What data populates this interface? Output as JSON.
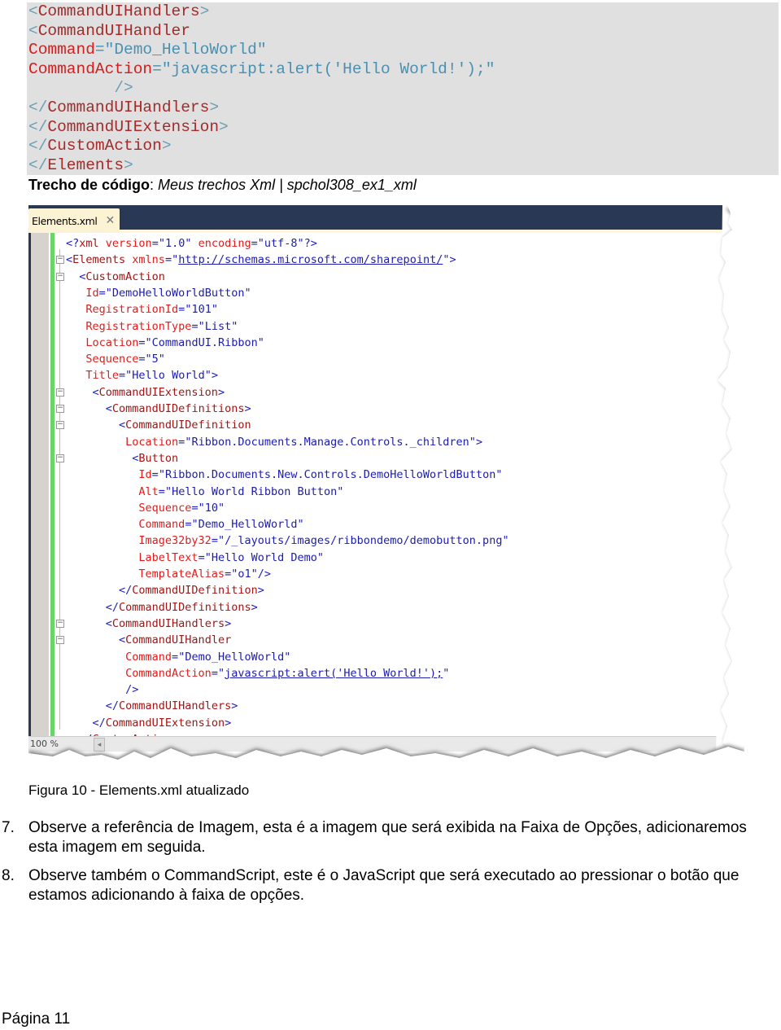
{
  "snippet": {
    "lines": [
      [
        {
          "t": "<",
          "c": "br"
        },
        {
          "t": "CommandUIHandlers",
          "c": "el"
        },
        {
          "t": ">",
          "c": "br"
        }
      ],
      [
        {
          "t": "<",
          "c": "br"
        },
        {
          "t": "CommandUIHandler",
          "c": "el"
        }
      ],
      [
        {
          "t": "Command",
          "c": "at"
        },
        {
          "t": "=\"Demo_HelloWorld\"",
          "c": "va"
        }
      ],
      [
        {
          "t": "CommandAction",
          "c": "at"
        },
        {
          "t": "=\"javascript:alert('Hello World!');\"",
          "c": "va"
        }
      ],
      [
        {
          "t": "         />",
          "c": "br"
        }
      ],
      [
        {
          "t": "</",
          "c": "br"
        },
        {
          "t": "CommandUIHandlers",
          "c": "el"
        },
        {
          "t": ">",
          "c": "br"
        }
      ],
      [
        {
          "t": "</",
          "c": "br"
        },
        {
          "t": "CommandUIExtension",
          "c": "el"
        },
        {
          "t": ">",
          "c": "br"
        }
      ],
      [
        {
          "t": "</",
          "c": "br"
        },
        {
          "t": "CustomAction",
          "c": "el"
        },
        {
          "t": ">",
          "c": "br"
        }
      ],
      [
        {
          "t": "</",
          "c": "br"
        },
        {
          "t": "Elements",
          "c": "el"
        },
        {
          "t": ">",
          "c": "br"
        }
      ]
    ],
    "caption_bold": "Trecho de código",
    "caption_sep": ": ",
    "caption_italic": "Meus trechos Xml | spchol308_ex1_xml"
  },
  "editor": {
    "tab_label": "Elements.xml",
    "tab_close_icon": "✕",
    "zoom_label": "100 %",
    "scroll_left_icon": "◂",
    "fold_icon": "−",
    "lines": [
      [
        {
          "t": "<?",
          "c": "pu"
        },
        {
          "t": "xml",
          "c": "el"
        },
        {
          "t": " version",
          "c": "at"
        },
        {
          "t": "=",
          "c": "pu"
        },
        {
          "t": "\"1.0\"",
          "c": "va"
        },
        {
          "t": " encoding",
          "c": "at"
        },
        {
          "t": "=",
          "c": "pu"
        },
        {
          "t": "\"utf-8\"",
          "c": "va"
        },
        {
          "t": "?>",
          "c": "pu"
        }
      ],
      [
        {
          "t": "<",
          "c": "pu"
        },
        {
          "t": "Elements",
          "c": "el"
        },
        {
          "t": " xmlns",
          "c": "at"
        },
        {
          "t": "=\"",
          "c": "pu"
        },
        {
          "t": "http://schemas.microsoft.com/sharepoint/",
          "c": "ln"
        },
        {
          "t": "\">",
          "c": "pu"
        }
      ],
      [
        {
          "t": "  <",
          "c": "pu"
        },
        {
          "t": "CustomAction",
          "c": "el"
        }
      ],
      [
        {
          "t": "   Id",
          "c": "at"
        },
        {
          "t": "=",
          "c": "pu"
        },
        {
          "t": "\"DemoHelloWorldButton\"",
          "c": "va"
        }
      ],
      [
        {
          "t": "   RegistrationId",
          "c": "at"
        },
        {
          "t": "=",
          "c": "pu"
        },
        {
          "t": "\"101\"",
          "c": "va"
        }
      ],
      [
        {
          "t": "   RegistrationType",
          "c": "at"
        },
        {
          "t": "=",
          "c": "pu"
        },
        {
          "t": "\"List\"",
          "c": "va"
        }
      ],
      [
        {
          "t": "   Location",
          "c": "at"
        },
        {
          "t": "=",
          "c": "pu"
        },
        {
          "t": "\"CommandUI.Ribbon\"",
          "c": "va"
        }
      ],
      [
        {
          "t": "   Sequence",
          "c": "at"
        },
        {
          "t": "=",
          "c": "pu"
        },
        {
          "t": "\"5\"",
          "c": "va"
        }
      ],
      [
        {
          "t": "   Title",
          "c": "at"
        },
        {
          "t": "=",
          "c": "pu"
        },
        {
          "t": "\"Hello World\"",
          "c": "va"
        },
        {
          "t": ">",
          "c": "pu"
        }
      ],
      [
        {
          "t": "    <",
          "c": "pu"
        },
        {
          "t": "CommandUIExtension",
          "c": "el"
        },
        {
          "t": ">",
          "c": "pu"
        }
      ],
      [
        {
          "t": "      <",
          "c": "pu"
        },
        {
          "t": "CommandUIDefinitions",
          "c": "el"
        },
        {
          "t": ">",
          "c": "pu"
        }
      ],
      [
        {
          "t": "        <",
          "c": "pu"
        },
        {
          "t": "CommandUIDefinition",
          "c": "el"
        }
      ],
      [
        {
          "t": "         Location",
          "c": "at"
        },
        {
          "t": "=",
          "c": "pu"
        },
        {
          "t": "\"Ribbon.Documents.Manage.Controls._children\"",
          "c": "va"
        },
        {
          "t": ">",
          "c": "pu"
        }
      ],
      [
        {
          "t": "          <",
          "c": "pu"
        },
        {
          "t": "Button",
          "c": "el"
        }
      ],
      [
        {
          "t": "           Id",
          "c": "at"
        },
        {
          "t": "=",
          "c": "pu"
        },
        {
          "t": "\"Ribbon.Documents.New.Controls.DemoHelloWorldButton\"",
          "c": "va"
        }
      ],
      [
        {
          "t": "           Alt",
          "c": "at"
        },
        {
          "t": "=",
          "c": "pu"
        },
        {
          "t": "\"Hello World Ribbon Button\"",
          "c": "va"
        }
      ],
      [
        {
          "t": "           Sequence",
          "c": "at"
        },
        {
          "t": "=",
          "c": "pu"
        },
        {
          "t": "\"10\"",
          "c": "va"
        }
      ],
      [
        {
          "t": "           Command",
          "c": "at"
        },
        {
          "t": "=",
          "c": "pu"
        },
        {
          "t": "\"Demo_HelloWorld\"",
          "c": "va"
        }
      ],
      [
        {
          "t": "           Image32by32",
          "c": "at"
        },
        {
          "t": "=",
          "c": "pu"
        },
        {
          "t": "\"/_layouts/images/ribbondemo/demobutton.png\"",
          "c": "va"
        }
      ],
      [
        {
          "t": "           LabelText",
          "c": "at"
        },
        {
          "t": "=",
          "c": "pu"
        },
        {
          "t": "\"Hello World Demo\"",
          "c": "va"
        }
      ],
      [
        {
          "t": "           TemplateAlias",
          "c": "at"
        },
        {
          "t": "=",
          "c": "pu"
        },
        {
          "t": "\"o1\"",
          "c": "va"
        },
        {
          "t": "/>",
          "c": "pu"
        }
      ],
      [
        {
          "t": "        </",
          "c": "pu"
        },
        {
          "t": "CommandUIDefinition",
          "c": "el"
        },
        {
          "t": ">",
          "c": "pu"
        }
      ],
      [
        {
          "t": "      </",
          "c": "pu"
        },
        {
          "t": "CommandUIDefinitions",
          "c": "el"
        },
        {
          "t": ">",
          "c": "pu"
        }
      ],
      [
        {
          "t": "      <",
          "c": "pu"
        },
        {
          "t": "CommandUIHandlers",
          "c": "el"
        },
        {
          "t": ">",
          "c": "pu"
        }
      ],
      [
        {
          "t": "        <",
          "c": "pu"
        },
        {
          "t": "CommandUIHandler",
          "c": "el"
        }
      ],
      [
        {
          "t": "         Command",
          "c": "at"
        },
        {
          "t": "=",
          "c": "pu"
        },
        {
          "t": "\"Demo_HelloWorld\"",
          "c": "va"
        }
      ],
      [
        {
          "t": "         CommandAction",
          "c": "at"
        },
        {
          "t": "=\"",
          "c": "pu"
        },
        {
          "t": "javascript:alert('Hello World!');",
          "c": "ln"
        },
        {
          "t": "\"",
          "c": "pu"
        }
      ],
      [
        {
          "t": "         />",
          "c": "pu"
        }
      ],
      [
        {
          "t": "      </",
          "c": "pu"
        },
        {
          "t": "CommandUIHandlers",
          "c": "el"
        },
        {
          "t": ">",
          "c": "pu"
        }
      ],
      [
        {
          "t": "    </",
          "c": "pu"
        },
        {
          "t": "CommandUIExtension",
          "c": "el"
        },
        {
          "t": ">",
          "c": "pu"
        }
      ],
      [
        {
          "t": "  </",
          "c": "pu"
        },
        {
          "t": "CustomAction",
          "c": "el"
        },
        {
          "t": ">",
          "c": "pu"
        }
      ]
    ],
    "fold_rows": [
      1,
      2,
      9,
      10,
      11,
      13,
      23,
      24
    ]
  },
  "figure_caption": "Figura 10 - Elements.xml atualizado",
  "list": [
    {
      "num": "7.",
      "text": "Observe a referência de Imagem, esta é a imagem que será exibida na Faixa de Opções, adicionaremos esta imagem em seguida."
    },
    {
      "num": "8.",
      "text": "Observe também o CommandScript, este é o JavaScript que será executado ao pressionar o botão que estamos adicionando à faixa de opções."
    }
  ],
  "footer": {
    "page_label": "Página 11"
  }
}
